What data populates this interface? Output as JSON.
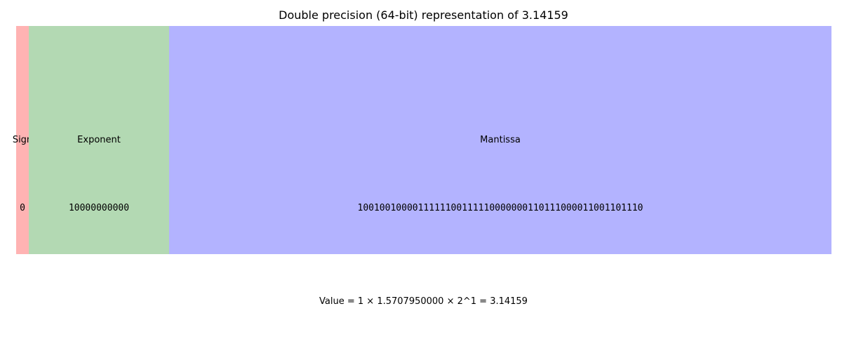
{
  "title": "Double precision (64-bit) representation of 3.14159",
  "fields": {
    "sign": {
      "label": "Sign",
      "bits": "0",
      "color": "#ffb3b3"
    },
    "exponent": {
      "label": "Exponent",
      "bits": "10000000000",
      "color": "#b3d9b3"
    },
    "mantissa": {
      "label": "Mantissa",
      "bits": "1001001000011111100111110000000110111000011001101110",
      "color": "#b3b3ff"
    }
  },
  "value_line": "Value = 1 × 1.5707950000 × 2^1 = 3.14159"
}
